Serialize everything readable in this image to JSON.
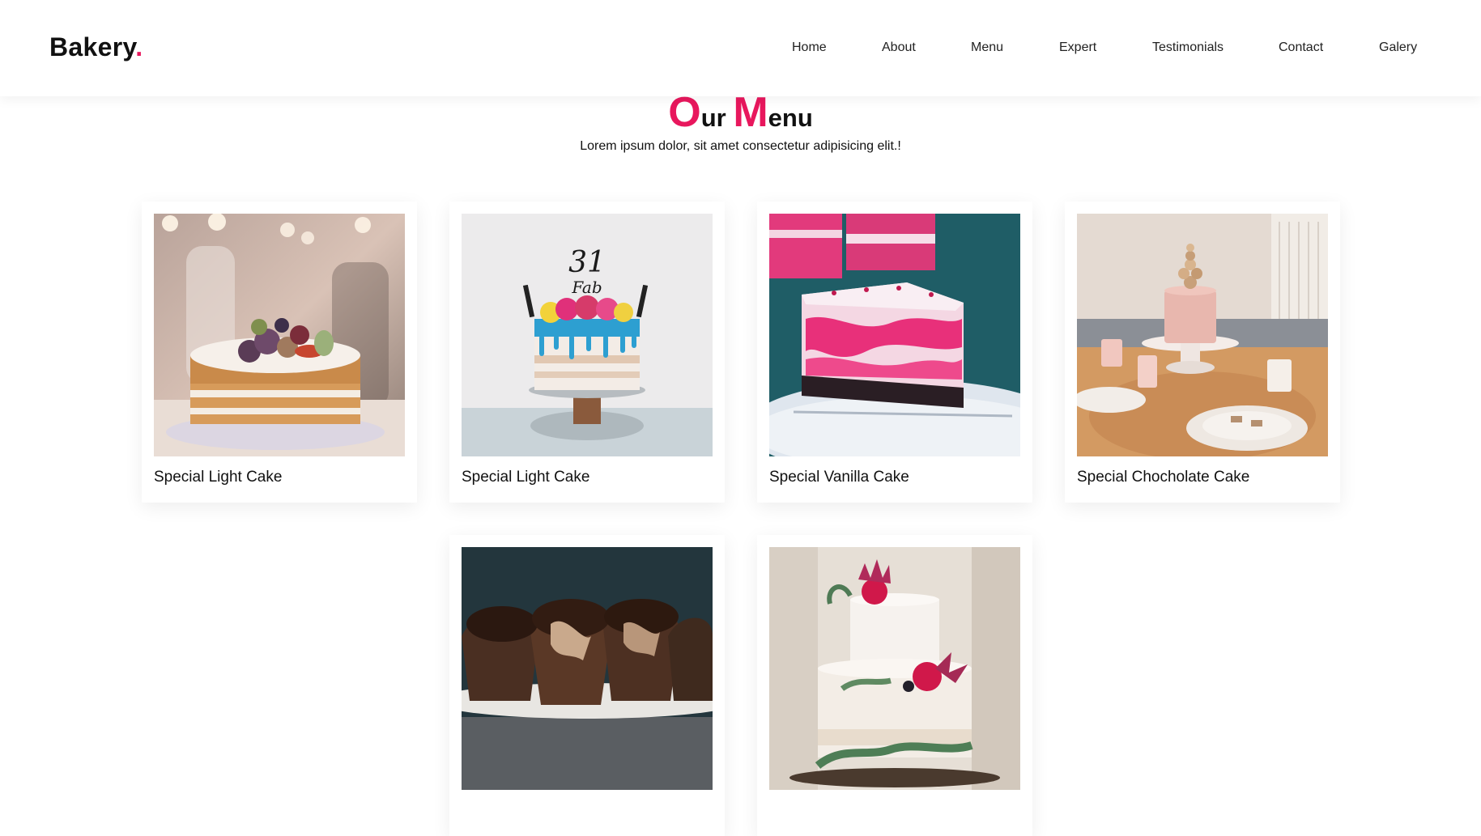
{
  "brand": {
    "name": "Bakery",
    "dot": ".",
    "accent_color": "#e8175d"
  },
  "nav": [
    "Home",
    "About",
    "Menu",
    "Expert",
    "Testimonials",
    "Contact",
    "Galery"
  ],
  "section": {
    "title_first_cap": "O",
    "title_first_rest": "ur",
    "title_second_cap": "M",
    "title_second_rest": "enu",
    "subtitle": "Lorem ipsum dolor, sit amet consectetur adipisicing elit.!"
  },
  "menu_items": [
    {
      "name": "Special Light Cake"
    },
    {
      "name": "Special Light Cake"
    },
    {
      "name": "Special Vanilla Cake"
    },
    {
      "name": "Special Chocholate Cake"
    },
    {
      "name": ""
    },
    {
      "name": ""
    }
  ]
}
